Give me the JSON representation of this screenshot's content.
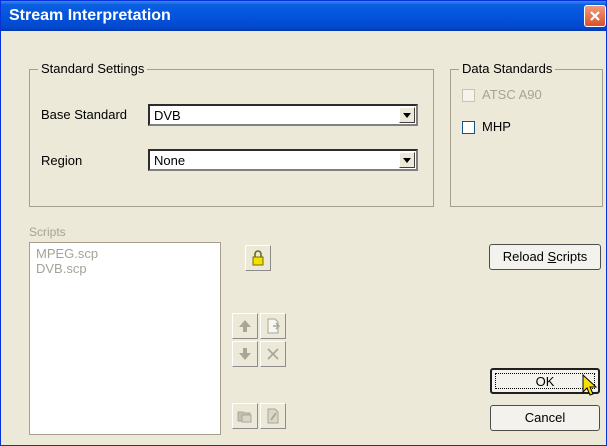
{
  "window": {
    "title": "Stream Interpretation"
  },
  "standard_settings": {
    "legend": "Standard Settings",
    "base_standard": {
      "label": "Base Standard",
      "value": "DVB"
    },
    "region": {
      "label": "Region",
      "value": "None"
    }
  },
  "data_standards": {
    "legend": "Data Standards",
    "atsc_a90": {
      "label": "ATSC A90",
      "checked": false,
      "enabled": false
    },
    "mhp": {
      "label": "MHP",
      "checked": false,
      "enabled": true
    }
  },
  "scripts": {
    "label": "Scripts",
    "items": [
      "MPEG.scp",
      "DVB.scp"
    ]
  },
  "buttons": {
    "reload": {
      "prefix": "Reload ",
      "mnemonic": "S",
      "suffix": "cripts"
    },
    "ok": "OK",
    "cancel": "Cancel"
  }
}
